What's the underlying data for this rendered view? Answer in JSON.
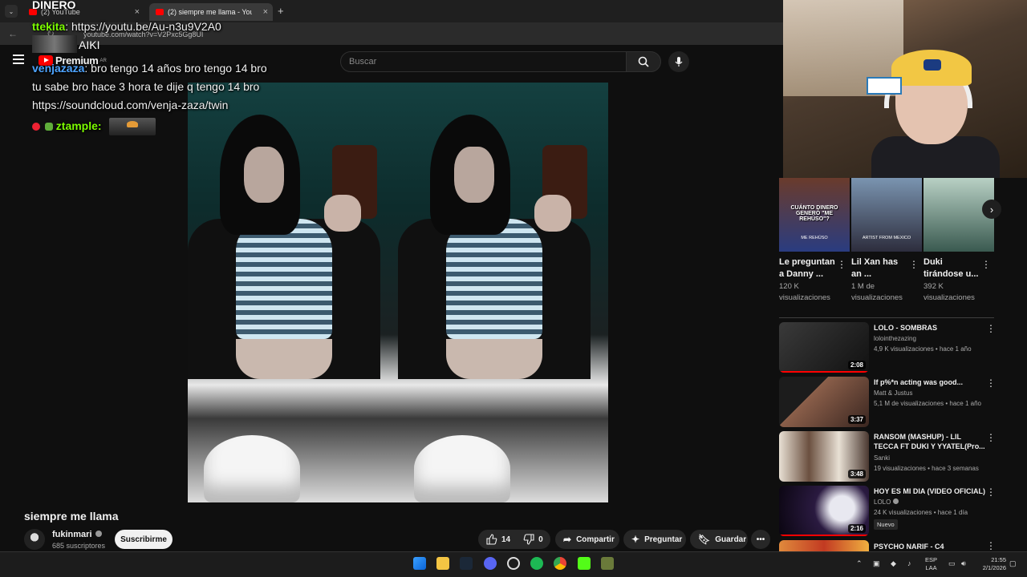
{
  "browser": {
    "tabs": [
      {
        "title": "(2) YouTube"
      },
      {
        "title": "(2) siempre me llama - YouTube"
      }
    ],
    "url": "youtube.com/watch?v=V2Pxc5Gg8UI"
  },
  "header": {
    "logo_text": "Premium",
    "country": "AR",
    "search_placeholder": "Buscar"
  },
  "overlay": {
    "top_label": "DINERO",
    "chat_1_user": "ttekita",
    "chat_1_text": ": https://youtu.be/Au-n3u9V2A0",
    "aiki": "AIKI",
    "chat_2_user": "venjazaza",
    "chat_2_line1": ": bro tengo 14 años bro tengo 14 bro",
    "chat_2_line2": "tu sabe bro hace 3 hora te dije q tengo 14 bro",
    "chat_2_line3": "https://soundcloud.com/venja-zaza/twin",
    "chat_3_user": "ztample",
    "chat_3_sep": ":"
  },
  "video": {
    "title": "siempre me llama",
    "channel": "fukinmari",
    "subscribers": "685 suscriptores",
    "subscribe_label": "Suscribirme",
    "likes": "14",
    "dislikes": "0",
    "share_label": "Compartir",
    "ask_label": "Preguntar",
    "save_label": "Guardar"
  },
  "shorts": [
    {
      "title": "Le preguntan a Danny ...",
      "views": "120 K visualizaciones",
      "overlay": "CUÁNTO DINERO GENERÓ \"ME REHÚSO\"?",
      "sub": "ME REHÚSO"
    },
    {
      "title": "Lil Xan has an ...",
      "views": "1 M de visualizaciones",
      "overlay": "",
      "sub": "ARTIST FROM MEXICO"
    },
    {
      "title": "Duki tirándose u...",
      "views": "392 K visualizaciones",
      "overlay": "",
      "sub": ""
    }
  ],
  "related": [
    {
      "title": "LOLO - SOMBRAS",
      "channel": "lolointhezazing",
      "meta": "4,9 K visualizaciones • hace 1 año",
      "duration": "2:08",
      "color": "#2a2a2a"
    },
    {
      "title": "If p%*n acting was good...",
      "channel": "Matt & Justus",
      "meta": "5,1 M de visualizaciones • hace 1 año",
      "duration": "3:37",
      "color": "#5a3d33"
    },
    {
      "title": "RANSOM (MASHUP) - LIL TECCA FT DUKI Y YYATEL(Pro...",
      "channel": "Sanki",
      "meta": "19 visualizaciones • hace 3 semanas",
      "duration": "3:48",
      "color": "#d8cfc2"
    },
    {
      "title": "HOY ES MI DIA (VIDEO OFICIAL)",
      "channel": "LOLO",
      "meta": "24 K visualizaciones • hace 1 día",
      "duration": "2:16",
      "badge": "Nuevo",
      "color": "#1a1030"
    },
    {
      "title": "PSYCHO NARIF - C4",
      "color": "#d06a2a"
    }
  ],
  "taskbar": {
    "lang_line1": "ESP",
    "lang_line2": "LAA",
    "time": "21:55",
    "date": "2/1/2026"
  },
  "colors": {
    "background": "#0f0f0f",
    "accent_red": "#ff0000",
    "chat_green": "#7cfc00",
    "chat_blue": "#4ea4ff"
  }
}
